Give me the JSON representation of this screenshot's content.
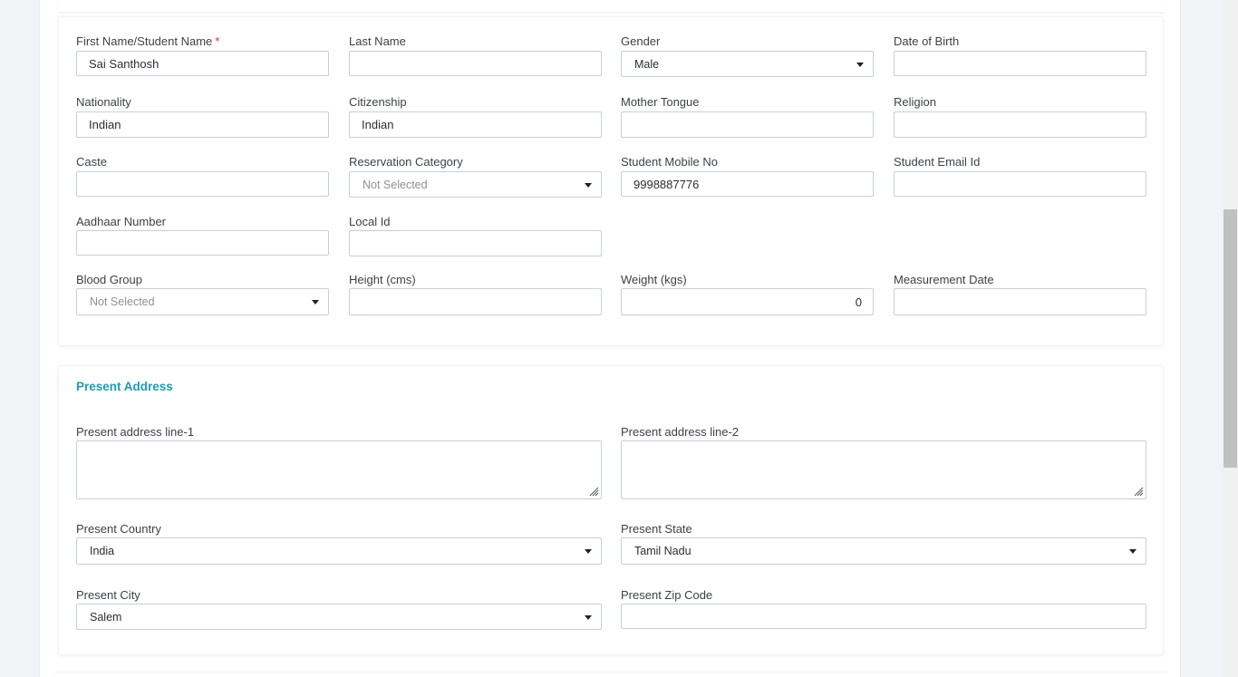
{
  "form": {
    "first_name_label": "First Name/Student Name",
    "required_mark": "*",
    "first_name_value": "Sai Santhosh",
    "last_name_label": "Last Name",
    "last_name_value": "",
    "gender_label": "Gender",
    "gender_value": "Male",
    "dob_label": "Date of Birth",
    "dob_value": "",
    "nationality_label": "Nationality",
    "nationality_value": "Indian",
    "citizenship_label": "Citizenship",
    "citizenship_value": "Indian",
    "mother_tongue_label": "Mother Tongue",
    "mother_tongue_value": "",
    "religion_label": "Religion",
    "religion_value": "",
    "caste_label": "Caste",
    "caste_value": "",
    "reservation_label": "Reservation Category",
    "reservation_value": "Not Selected",
    "mobile_label": "Student Mobile No",
    "mobile_value": "9998887776",
    "email_label": "Student Email Id",
    "email_value": "",
    "aadhaar_label": "Aadhaar Number",
    "aadhaar_value": "",
    "local_id_label": "Local Id",
    "local_id_value": "",
    "blood_group_label": "Blood Group",
    "blood_group_value": "Not Selected",
    "height_label": "Height (cms)",
    "height_value": "",
    "weight_label": "Weight (kgs)",
    "weight_value": "0",
    "measurement_date_label": "Measurement Date",
    "measurement_date_value": ""
  },
  "address": {
    "section_title": "Present Address",
    "line1_label": "Present address line-1",
    "line2_label": "Present address line-2",
    "country_label": "Present Country",
    "country_value": "India",
    "state_label": "Present State",
    "state_value": "Tamil Nadu",
    "city_label": "Present City",
    "city_value": "Salem",
    "zip_label": "Present Zip Code",
    "zip_value": ""
  },
  "icons": {
    "dropdown": "caret-down-icon",
    "resize": "resize-grip-icon"
  },
  "colors": {
    "accent": "#1f9bb6",
    "required": "#e3342f",
    "border": "#c9ced6",
    "background": "#f1f3f7"
  }
}
